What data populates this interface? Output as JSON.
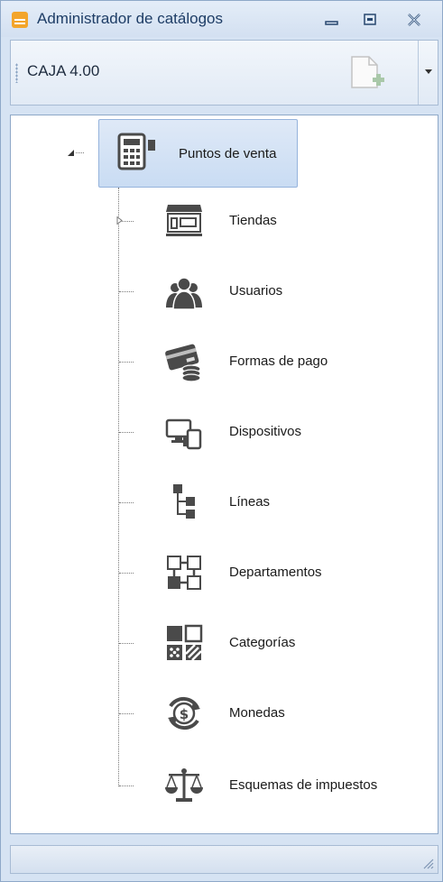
{
  "window": {
    "title": "Administrador de catálogos",
    "icon": "catalog-app-icon",
    "controls": [
      "minimize-icon",
      "restore-icon",
      "close-icon"
    ]
  },
  "toolbar": {
    "label": "CAJA 4.00",
    "new_button_icon": "new-document-icon",
    "dropdown_icon": "chevron-down-icon"
  },
  "tree": {
    "root": {
      "label": "Puntos de venta",
      "icon": "cash-register-icon",
      "expanded": true,
      "selected": true
    },
    "children": [
      {
        "label": "Tiendas",
        "icon": "store-icon",
        "has_children": true
      },
      {
        "label": "Usuarios",
        "icon": "users-icon"
      },
      {
        "label": "Formas de pago",
        "icon": "payment-card-icon"
      },
      {
        "label": "Dispositivos",
        "icon": "devices-icon"
      },
      {
        "label": "Líneas",
        "icon": "hierarchy-icon"
      },
      {
        "label": "Departamentos",
        "icon": "departments-icon"
      },
      {
        "label": "Categorías",
        "icon": "categories-icon"
      },
      {
        "label": "Monedas",
        "icon": "currency-exchange-icon"
      },
      {
        "label": "Esquemas de impuestos",
        "icon": "scales-icon"
      }
    ]
  },
  "colors": {
    "window_background": "#d6e3f3",
    "title_text": "#1e3d66",
    "selected_node": "#c9dcf3",
    "icon_gray": "#4a4a4a"
  }
}
